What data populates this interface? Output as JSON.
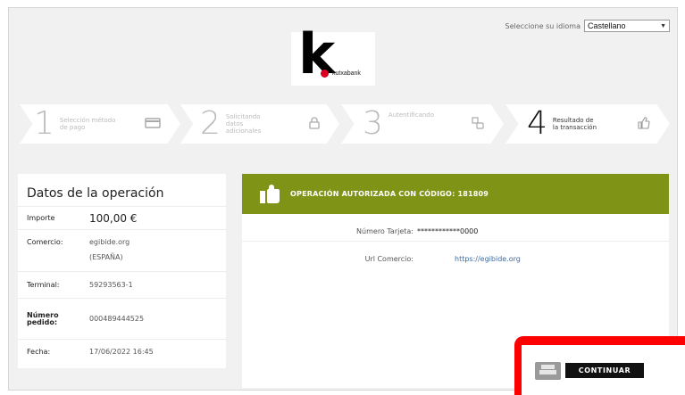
{
  "header": {
    "logo_letter": "k",
    "logo_text": "kutxabank",
    "language_label": "Seleccione su idioma",
    "language_selected": "Castellano"
  },
  "steps": [
    {
      "number": "1",
      "label": "Selección método de pago",
      "icon": "card-icon",
      "active": false
    },
    {
      "number": "2",
      "label": "Solicitando datos adicionales",
      "icon": "lock-icon",
      "active": false
    },
    {
      "number": "3",
      "label": "Autentificando",
      "icon": "authentication-icon",
      "active": false
    },
    {
      "number": "4",
      "label": "Resultado de la transacción",
      "icon": "thumbs-up-icon",
      "active": true
    }
  ],
  "operation": {
    "title": "Datos de la operación",
    "amount_label": "Importe",
    "amount_value": "100,00 €",
    "merchant_label": "Comercio:",
    "merchant_name": "egibide.org",
    "merchant_country": "(ESPAÑA)",
    "terminal_label": "Terminal:",
    "terminal_value": "59293563-1",
    "order_label": "Número pedido:",
    "order_value": "000489444525",
    "date_label": "Fecha:",
    "date_value": "17/06/2022  16:45"
  },
  "result": {
    "status_text": "OPERACIÓN AUTORIZADA CON CÓDIGO: 181809",
    "status_color": "#7f9317",
    "card_label": "Número Tarjeta:",
    "card_value": "************0000",
    "url_label": "Url Comercio:",
    "url_value": "https://egibide.org"
  },
  "actions": {
    "continue_label": "CONTINUAR",
    "highlight_color": "#ff0000"
  }
}
